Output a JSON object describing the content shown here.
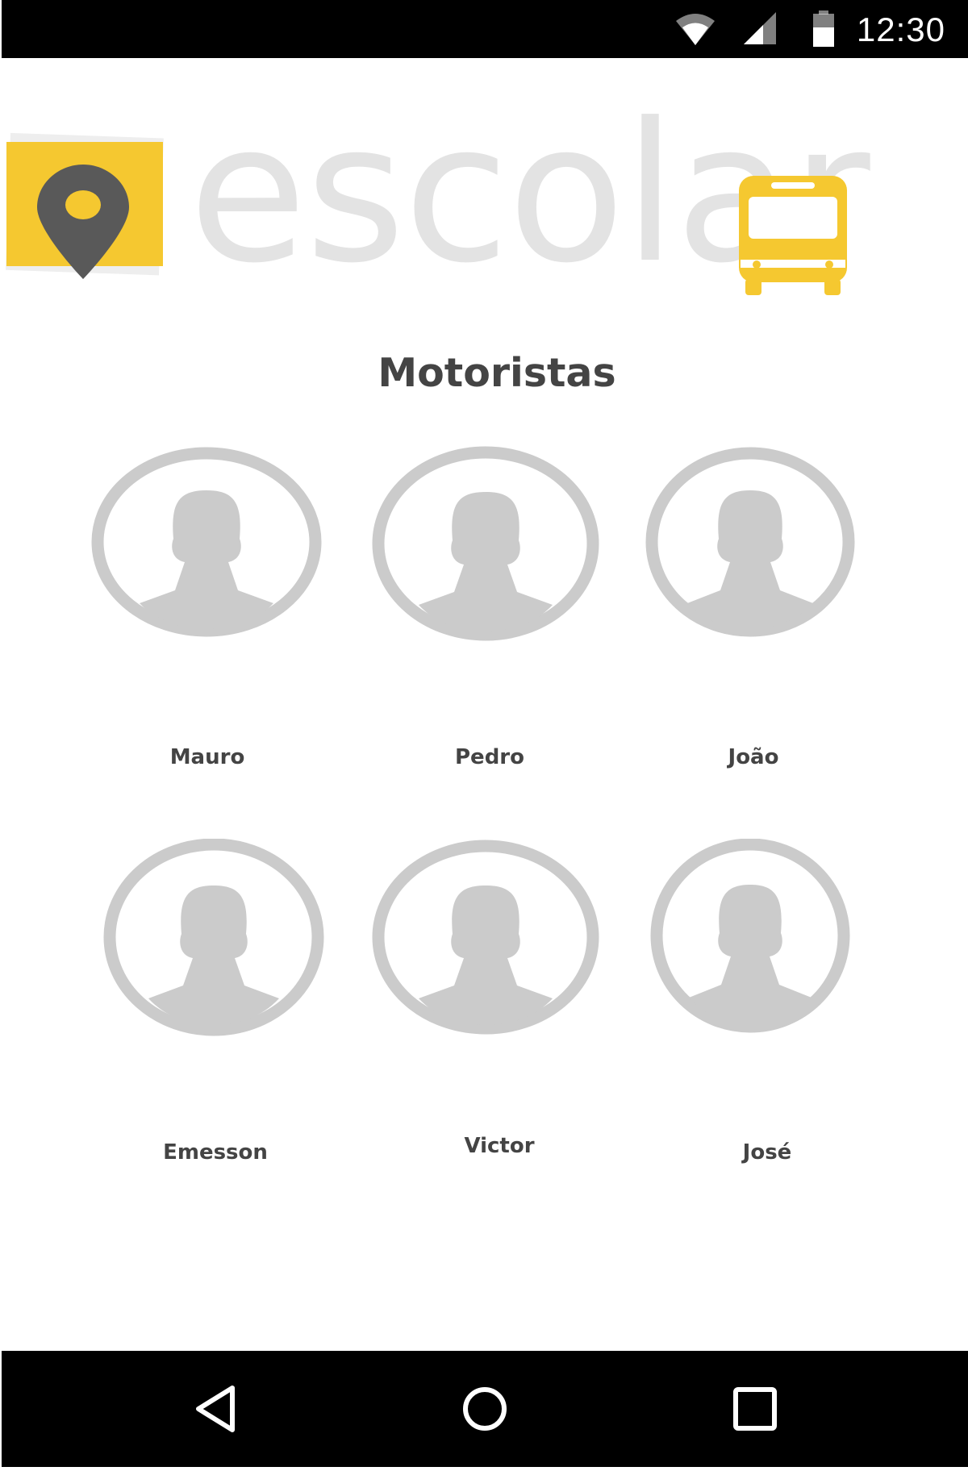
{
  "status_bar": {
    "time": "12:30",
    "icons": [
      "wifi-icon",
      "cellular-signal-icon",
      "battery-icon"
    ]
  },
  "logo": {
    "text": "escolar",
    "pin_color": "#595959",
    "accent_color": "#F5C830",
    "text_color": "#E3E3E3"
  },
  "page": {
    "title": "Motoristas"
  },
  "drivers": [
    {
      "name": "Mauro"
    },
    {
      "name": "Pedro"
    },
    {
      "name": "João"
    },
    {
      "name": "Emesson"
    },
    {
      "name": "Victor"
    },
    {
      "name": "José"
    }
  ],
  "nav_bar": {
    "buttons": [
      "back-icon",
      "home-icon",
      "recents-icon"
    ]
  },
  "colors": {
    "avatar_gray": "#CBCBCB",
    "text": "#444444",
    "bars": "#000000"
  }
}
